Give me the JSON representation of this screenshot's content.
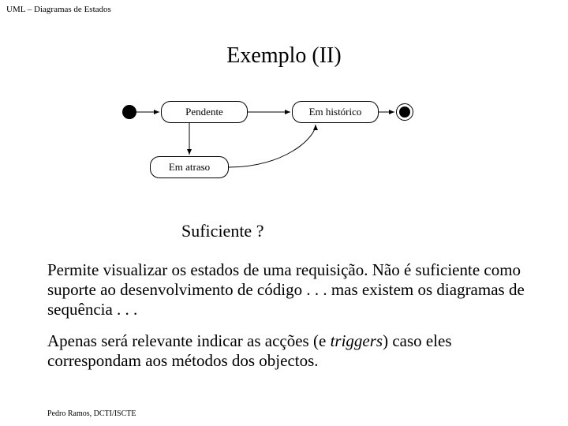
{
  "header": "UML – Diagramas de Estados",
  "title": "Exemplo (II)",
  "states": {
    "pendente": "Pendente",
    "historico": "Em histórico",
    "atraso": "Em atraso"
  },
  "question": "Suficiente ?",
  "paragraph1_a": "Permite visualizar os estados de uma requisição. Não é suficiente como suporte ao desenvolvimento de código . . . mas existem os diagramas de sequência . . .",
  "paragraph2_a": "Apenas será relevante indicar as acções (e ",
  "paragraph2_trigger": "triggers",
  "paragraph2_b": ") caso eles correspondam aos métodos dos objectos.",
  "footer": "Pedro Ramos, DCTI/ISCTE"
}
